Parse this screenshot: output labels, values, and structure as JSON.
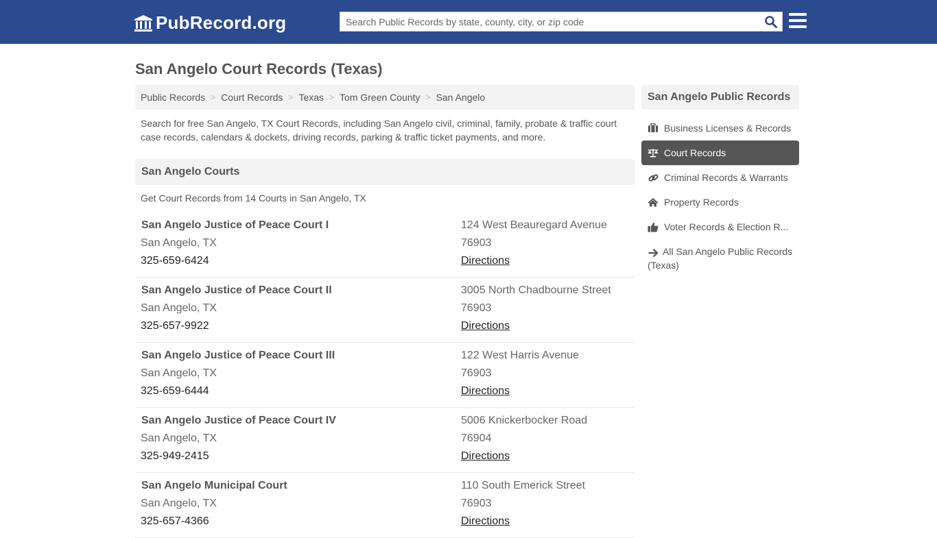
{
  "header": {
    "logo_text": "PubRecord.org",
    "logo_icon": "courthouse-icon",
    "search_placeholder": "Search Public Records by state, county, city, or zip code",
    "search_value": "",
    "search_icon": "search-icon",
    "menu_icon": "hamburger-menu-icon",
    "brand_color": "#2c4a90"
  },
  "page": {
    "title": "San Angelo Court Records (Texas)",
    "intro": "Search for free San Angelo, TX Court Records, including San Angelo civil, criminal, family, probate & traffic court case records, calendars & dockets, driving records, parking & traffic ticket payments, and more."
  },
  "breadcrumb": {
    "items": [
      "Public Records",
      "Court Records",
      "Texas",
      "Tom Green County"
    ],
    "current": "San Angelo",
    "separator": ">"
  },
  "courts_section": {
    "heading": "San Angelo Courts",
    "count_line": "Get Court Records from 14 Courts in San Angelo, TX",
    "directions_label": "Directions",
    "courts": [
      {
        "name": "San Angelo Justice of Peace Court I",
        "city": "San Angelo, TX",
        "phone": "325-659-6424",
        "address": "124 West Beauregard Avenue",
        "zip": "76903"
      },
      {
        "name": "San Angelo Justice of Peace Court II",
        "city": "San Angelo, TX",
        "phone": "325-657-9922",
        "address": "3005 North Chadbourne Street",
        "zip": "76903"
      },
      {
        "name": "San Angelo Justice of Peace Court III",
        "city": "San Angelo, TX",
        "phone": "325-659-6444",
        "address": "122 West Harris Avenue",
        "zip": "76903"
      },
      {
        "name": "San Angelo Justice of Peace Court IV",
        "city": "San Angelo, TX",
        "phone": "325-949-2415",
        "address": "5006 Knickerbocker Road",
        "zip": "76904"
      },
      {
        "name": "San Angelo Municipal Court",
        "city": "San Angelo, TX",
        "phone": "325-657-4366",
        "address": "110 South Emerick Street",
        "zip": "76903"
      }
    ]
  },
  "sidebar": {
    "heading": "San Angelo Public Records",
    "items": [
      {
        "label": "Business Licenses & Records",
        "icon": "briefcase-icon",
        "active": false
      },
      {
        "label": "Court Records",
        "icon": "scales-icon",
        "active": true
      },
      {
        "label": "Criminal Records & Warrants",
        "icon": "link-icon",
        "active": false
      },
      {
        "label": "Property Records",
        "icon": "home-icon",
        "active": false
      },
      {
        "label": "Voter Records & Election R...",
        "icon": "thumbs-up-icon",
        "active": false
      },
      {
        "label": "All San Angelo Public Records (Texas)",
        "icon": "arrow-right-icon",
        "active": false
      }
    ],
    "active_color": "#555555"
  }
}
